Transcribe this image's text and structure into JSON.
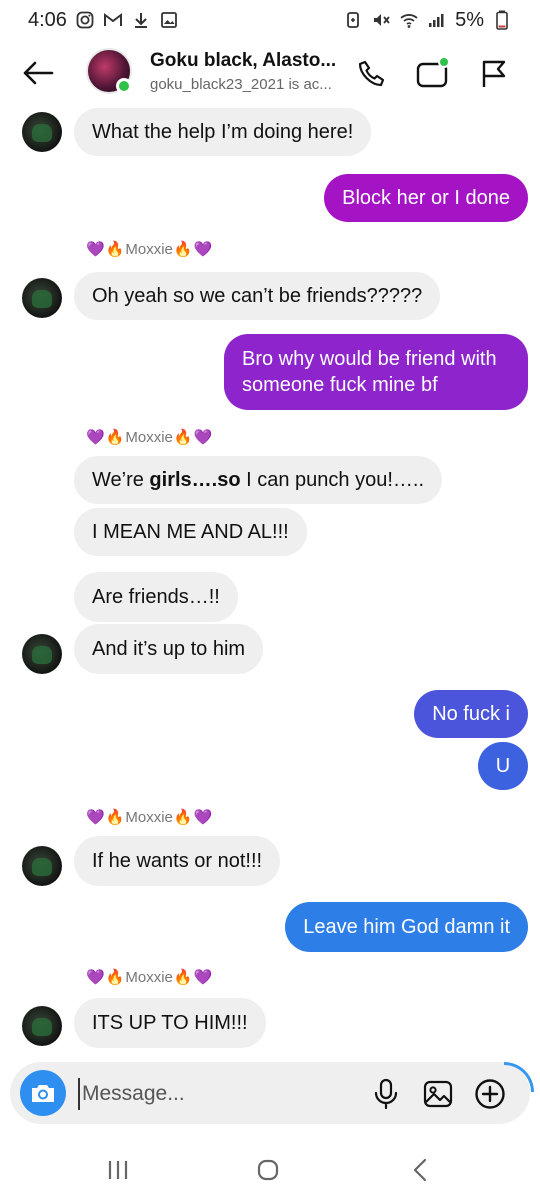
{
  "status_bar": {
    "time": "4:06",
    "battery": "5%",
    "left_icons": [
      "instagram-icon",
      "gmail-icon",
      "download-icon",
      "gallery-icon"
    ],
    "right_icons": [
      "battery-saver-icon",
      "mute-icon",
      "wifi-icon",
      "signal-icon",
      "battery-icon"
    ]
  },
  "header": {
    "name": "Goku black, Alasto...",
    "subtitle": "goku_black23_2021 is ac...",
    "icons": [
      "back-arrow-icon",
      "phone-icon",
      "video-icon",
      "flag-icon"
    ],
    "online": true
  },
  "sender_label": "Moxxie",
  "sender_emojis": {
    "heart": "💜",
    "fire": "🔥"
  },
  "messages": [
    {
      "side": "in",
      "text": "What the help I’m doing here!"
    },
    {
      "side": "out",
      "text": "Block her or I done",
      "color": "#a514c4"
    },
    {
      "side": "in",
      "text": "Oh yeah so we can’t be friends?????"
    },
    {
      "side": "out",
      "text": "Bro why would be friend with someone fuck mine bf",
      "color": "#8d24cc"
    },
    {
      "side": "in",
      "text_prefix": "We’re ",
      "text_bold": "girls….so",
      "text_suffix": " I can punch you!….."
    },
    {
      "side": "in",
      "text": "I MEAN ME AND AL!!!"
    },
    {
      "side": "in",
      "text": "Are friends…!!"
    },
    {
      "side": "in",
      "text": "And it’s up to him"
    },
    {
      "side": "out",
      "text": "No fuck i",
      "color": "#4a55dc"
    },
    {
      "side": "out",
      "text": "U",
      "color": "#3d62e0"
    },
    {
      "side": "in",
      "text": "If he wants or not!!!"
    },
    {
      "side": "out",
      "text": "Leave him God damn it",
      "color": "#2d7ee6"
    },
    {
      "side": "in",
      "text": "ITS UP TO HIM!!!"
    }
  ],
  "composer": {
    "placeholder": "Message...",
    "icons": [
      "camera-icon",
      "mic-icon",
      "gallery-icon",
      "plus-icon"
    ]
  },
  "nav": {
    "icons": [
      "recents-icon",
      "home-icon",
      "back-icon"
    ]
  }
}
